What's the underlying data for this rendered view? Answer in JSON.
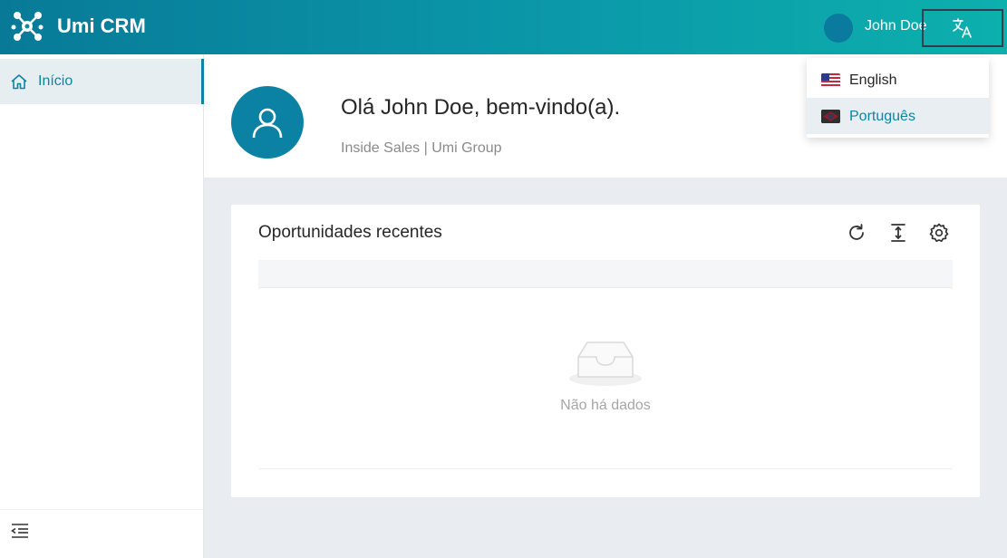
{
  "header": {
    "app_title": "Umi CRM",
    "user_name": "John Doe",
    "colors": {
      "gradient_start": "#087a98",
      "gradient_end": "#0cb0ad",
      "avatar": "#0a7a9e"
    }
  },
  "sidebar": {
    "items": [
      {
        "label": "Início",
        "icon": "home-icon",
        "active": true
      }
    ],
    "footer_icon": "collapse-menu-icon"
  },
  "profile": {
    "greeting": "Olá John Doe, bem-vindo(a).",
    "subtitle": "Inside Sales | Umi Group",
    "avatar_icon": "user-icon"
  },
  "recent_opportunities": {
    "title": "Oportunidades recentes",
    "toolbar_icons": [
      "refresh-icon",
      "column-height-icon",
      "settings-icon"
    ],
    "empty_text": "Não há dados"
  },
  "language_menu": {
    "items": [
      {
        "label": "English",
        "flag": "us-flag-icon",
        "selected": false
      },
      {
        "label": "Português",
        "flag": "br-flag-icon",
        "selected": true
      }
    ]
  },
  "theme": {
    "accent": "#0d84a3",
    "background": "#e9edf1"
  }
}
